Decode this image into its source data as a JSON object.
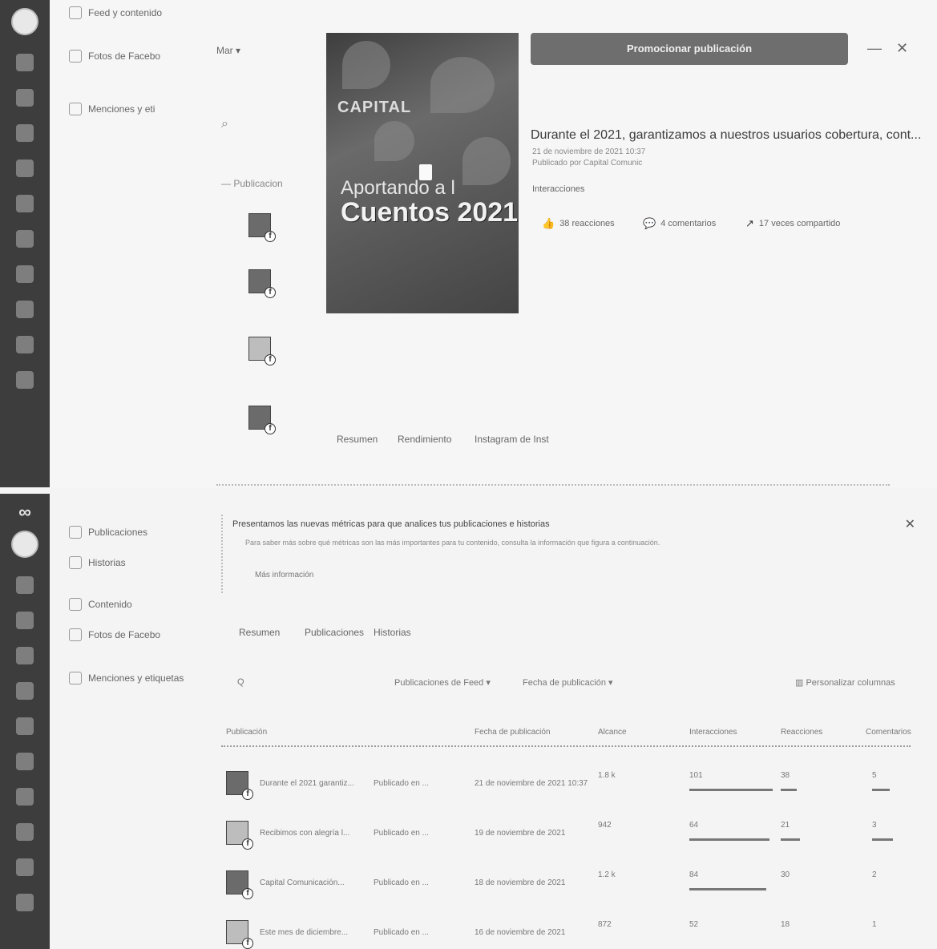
{
  "top_panel": {
    "nav": [
      {
        "label": "Feed y contenido"
      },
      {
        "label": "Fotos de Facebo"
      },
      {
        "label": "Menciones y eti"
      }
    ],
    "filter_label": "Mar",
    "publications_col": "Publicacion",
    "post": {
      "image_caption_top": "CAPITAL",
      "image_subhead": "Aportando a l",
      "image_headline": "Cuentos 2021",
      "promote_button": "Promocionar publicación",
      "title": "Durante el 2021, garantizamos a nuestros usuarios cobertura, cont...",
      "date": "21 de noviembre de 2021 10:37",
      "author": "Publicado por Capital Comunic",
      "interactions_label": "Interacciones",
      "reactions": [
        {
          "icon": "👍",
          "label": "38 reacciones"
        },
        {
          "icon": "💬",
          "label": "4 comentarios"
        },
        {
          "icon": "↗",
          "label": "17 veces compartido"
        }
      ]
    },
    "bottom_tabs": [
      "Resumen",
      "Rendimiento",
      "Instagram de Inst"
    ]
  },
  "bottom_panel": {
    "nav": [
      {
        "label": "Publicaciones"
      },
      {
        "label": "Historias"
      },
      {
        "label": "Contenido"
      },
      {
        "label": "Fotos de Facebo"
      },
      {
        "label": "Menciones y etiquetas"
      }
    ],
    "banner": {
      "title": "Presentamos las nuevas métricas para que analices tus publicaciones e historias",
      "text": "Para saber más sobre qué métricas son las más importantes para tu contenido, consulta la información que figura a continuación.",
      "link": "Más información"
    },
    "tabs": [
      "Resumen",
      "Publicaciones",
      "Historias"
    ],
    "toolbar": {
      "search": "Q",
      "filter1": "Publicaciones de Feed ▾",
      "filter2": "Fecha de publicación ▾",
      "customize": "Personalizar columnas"
    },
    "table": {
      "headers": [
        "Publicación",
        "Fecha de publicación",
        "Alcance",
        "Interacciones",
        "Reacciones",
        "Comentarios"
      ],
      "rows": [
        {
          "title": "Durante el 2021 garantiz...",
          "status": "Publicado en ...",
          "date": "21 de noviembre de 2021 10:37",
          "reach": "1.8 k",
          "interactions": "101",
          "reactions": "38",
          "comments": "5"
        },
        {
          "title": "Recibimos con alegría l...",
          "status": "Publicado en ...",
          "date": "19 de noviembre de 2021",
          "reach": "942",
          "interactions": "64",
          "reactions": "21",
          "comments": "3"
        },
        {
          "title": "Capital Comunicación...",
          "status": "Publicado en ...",
          "date": "18 de noviembre de 2021",
          "reach": "1.2 k",
          "interactions": "84",
          "reactions": "30",
          "comments": "2"
        },
        {
          "title": "Este mes de diciembre...",
          "status": "Publicado en ...",
          "date": "16 de noviembre de 2021",
          "reach": "872",
          "interactions": "52",
          "reactions": "18",
          "comments": "1"
        }
      ]
    }
  }
}
